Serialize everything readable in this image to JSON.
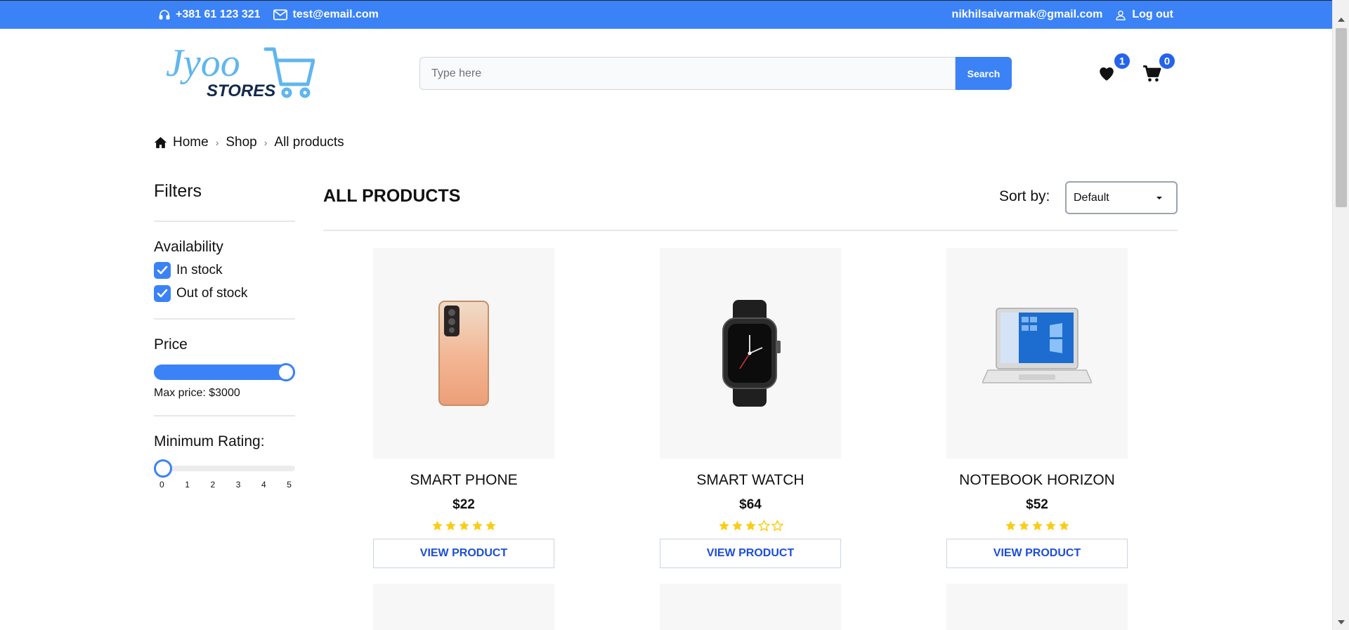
{
  "topbar": {
    "phone": "+381 61 123 321",
    "email": "test@email.com",
    "user_email": "nikhilsaivarmak@gmail.com",
    "logout_label": "Log out",
    "bg_color": "#3b82f6"
  },
  "header": {
    "logo": {
      "line1": "Jyoo",
      "line2": "STORES"
    },
    "search": {
      "placeholder": "Type here",
      "value": "",
      "button_label": "Search"
    },
    "wishlist_count": "1",
    "cart_count": "0"
  },
  "breadcrumb": {
    "items": [
      "Home",
      "Shop",
      "All products"
    ]
  },
  "filters": {
    "title": "Filters",
    "availability": {
      "title": "Availability",
      "options": [
        {
          "label": "In stock",
          "checked": true
        },
        {
          "label": "Out of stock",
          "checked": true
        }
      ]
    },
    "price": {
      "title": "Price",
      "max_label": "Max price: $3000",
      "value_fraction": 1.0
    },
    "rating": {
      "title": "Minimum Rating:",
      "ticks": [
        "0",
        "1",
        "2",
        "3",
        "4",
        "5"
      ],
      "value": 0
    }
  },
  "main": {
    "title": "ALL PRODUCTS",
    "sort": {
      "label": "Sort by:",
      "selected": "Default"
    }
  },
  "products": [
    {
      "name": "SMART PHONE",
      "price": "$22",
      "rating": 5,
      "button_label": "VIEW PRODUCT",
      "image": "phone-image"
    },
    {
      "name": "SMART WATCH",
      "price": "$64",
      "rating": 3,
      "button_label": "VIEW PRODUCT",
      "image": "watch-image"
    },
    {
      "name": "NOTEBOOK HORIZON",
      "price": "$52",
      "rating": 5,
      "button_label": "VIEW PRODUCT",
      "image": "laptop-image"
    }
  ],
  "colors": {
    "accent": "#3b82f6",
    "star": "#facc15",
    "button_text": "#1d4ed8"
  }
}
